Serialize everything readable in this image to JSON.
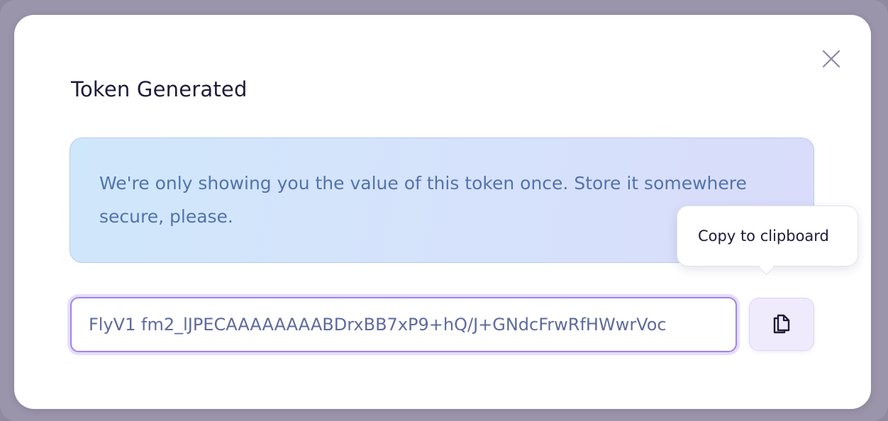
{
  "modal": {
    "title": "Token Generated",
    "notice": "We're only showing you the value of this token once. Store it somewhere secure, please.",
    "token_value": "FlyV1 fm2_lJPECAAAAAAAABDrxBB7xP9+hQ/J+GNdcFrwRfHWwrVoc",
    "close_icon": "close-icon",
    "copy_icon": "copy-icon"
  },
  "tooltip": {
    "text": "Copy to clipboard"
  },
  "colors": {
    "accent": "#9f84e8",
    "notice_text": "#5273ad",
    "title_text": "#1e1b3a"
  }
}
